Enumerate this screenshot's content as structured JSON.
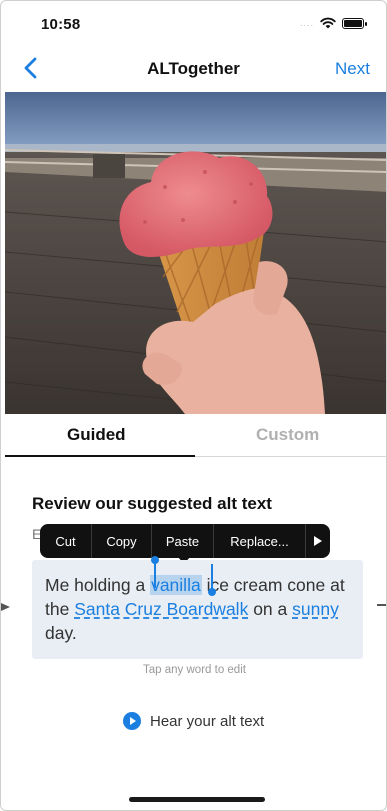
{
  "status_bar": {
    "time": "10:58",
    "signal": "....",
    "wifi_icon": "wifi-icon",
    "battery_icon": "battery-icon"
  },
  "nav": {
    "title": "ALTogether",
    "next_label": "Next",
    "back_icon": "chevron-left-icon"
  },
  "tabs": [
    {
      "label": "Guided",
      "selected": true
    },
    {
      "label": "Custom",
      "selected": false
    }
  ],
  "review": {
    "heading": "Review our suggested alt text",
    "subtitle_fragment": "E"
  },
  "edit_menu": {
    "items": [
      "Cut",
      "Copy",
      "Paste",
      "Replace..."
    ],
    "more_icon": "play-right-icon"
  },
  "alt_text": {
    "segments": [
      {
        "text": "Me holding a ",
        "type": "plain"
      },
      {
        "text": "vanilla",
        "type": "selected"
      },
      {
        "text": " ice cream cone at the ",
        "type": "plain"
      },
      {
        "text": "Santa Cruz Boardwalk",
        "type": "editable"
      },
      {
        "text": " on a ",
        "type": "plain"
      },
      {
        "text": "sunny",
        "type": "editable"
      },
      {
        "text": " day.",
        "type": "plain"
      }
    ]
  },
  "hint": "Tap any word to edit",
  "hear": {
    "label": "Hear your alt text",
    "icon": "play-circle-icon"
  },
  "colors": {
    "accent": "#1a7fe0",
    "box_bg": "#e8eef4",
    "selection": "#b7d3ee",
    "menu_bg": "#111111"
  }
}
